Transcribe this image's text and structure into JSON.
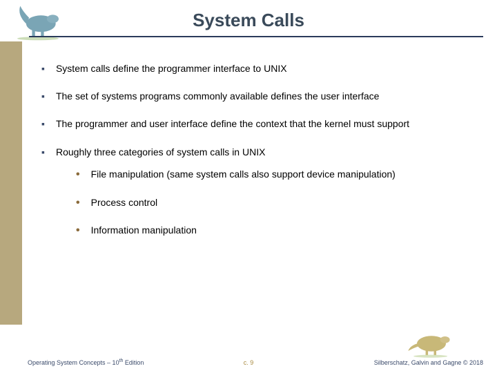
{
  "title": "System Calls",
  "bullets": [
    {
      "text": "System calls define the programmer interface to UNIX"
    },
    {
      "text": "The set of systems programs commonly available defines the user interface"
    },
    {
      "text": "The programmer and user interface define the context that the kernel must support"
    },
    {
      "text": "Roughly three categories of system calls in UNIX",
      "subs": [
        "File manipulation (same system calls also support device manipulation)",
        "Process control",
        "Information manipulation"
      ]
    }
  ],
  "footer": {
    "left_pre": "Operating System Concepts – 10",
    "left_sup": "th",
    "left_post": " Edition",
    "center": "c. 9",
    "right": "Silberschatz, Galvin and Gagne © 2018"
  }
}
